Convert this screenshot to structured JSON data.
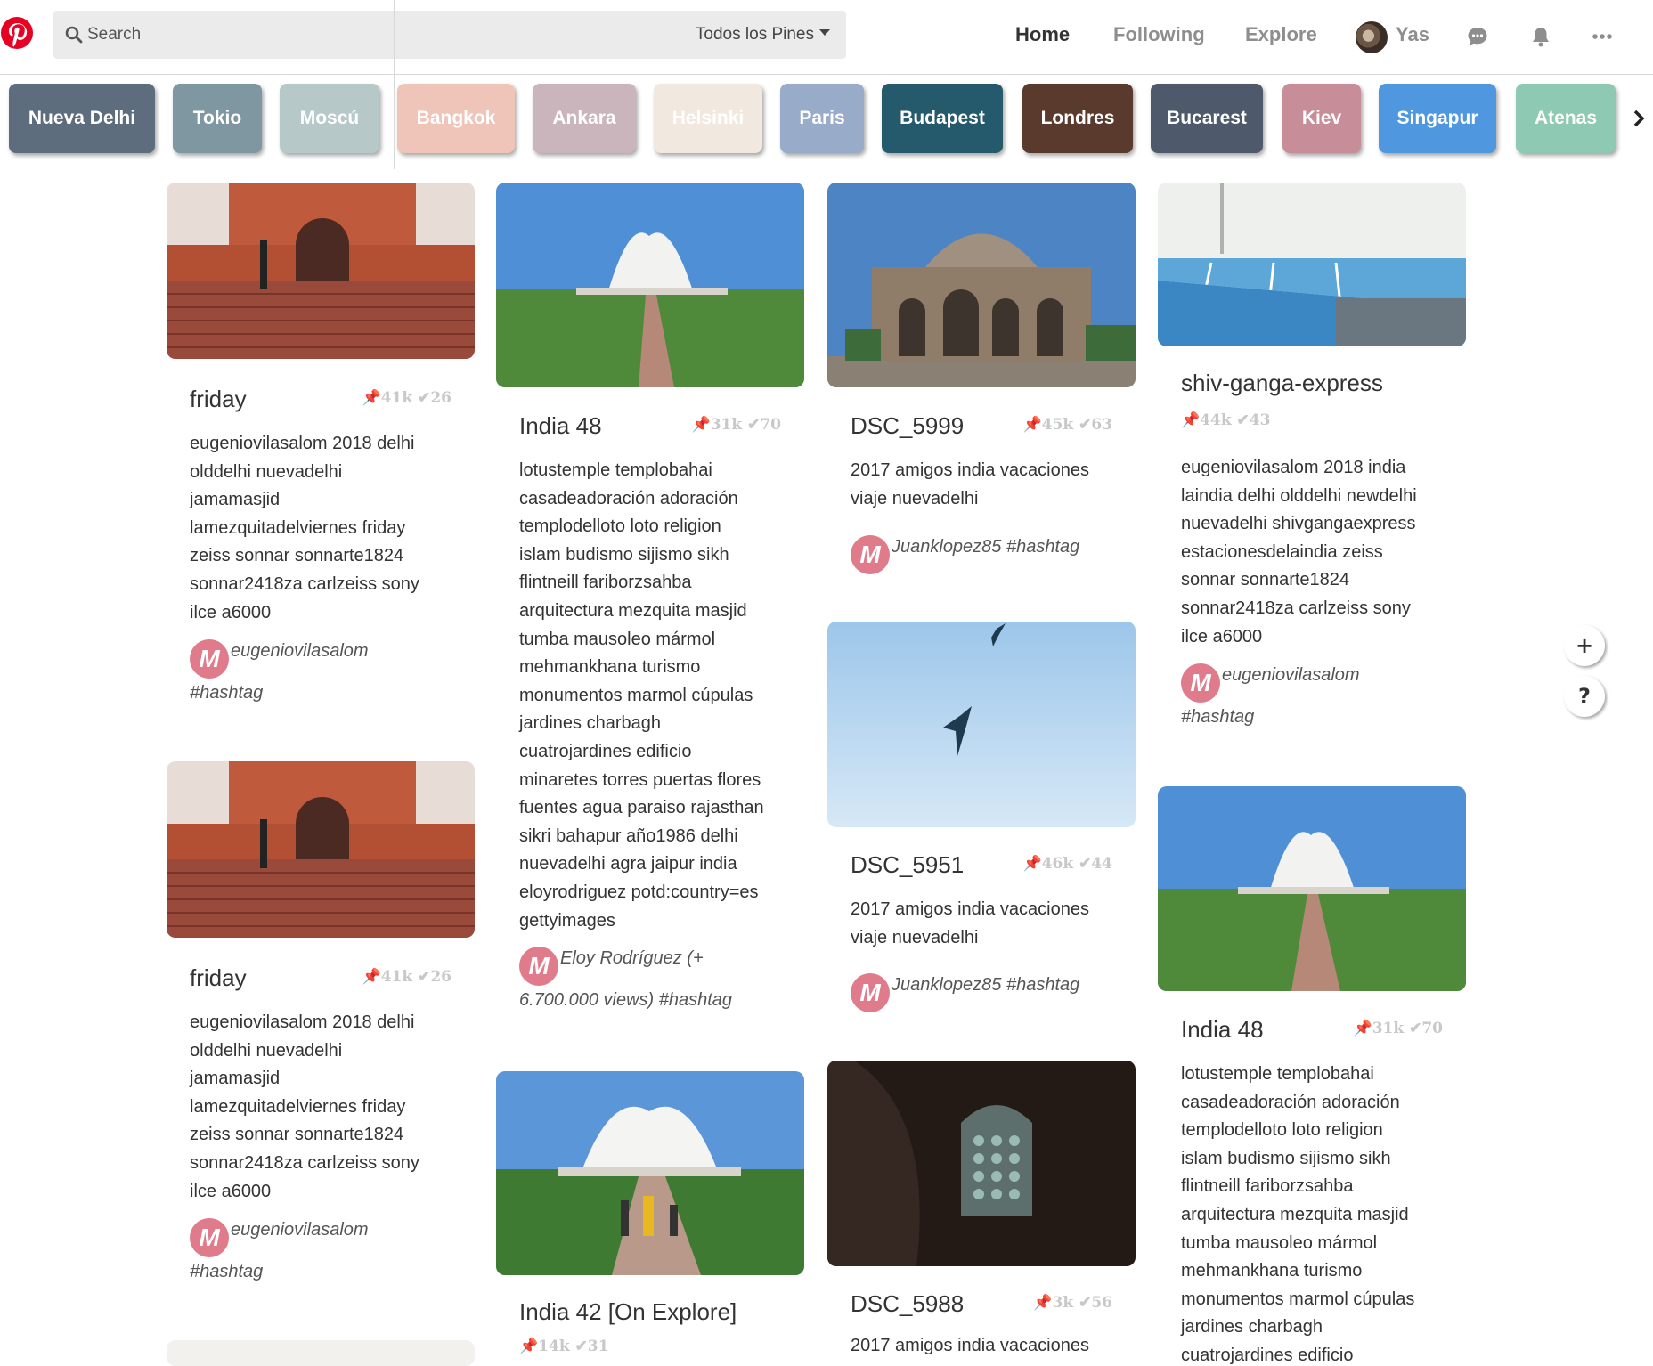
{
  "header": {
    "search_placeholder": "Search",
    "search_scope": "Todos los Pines",
    "nav": {
      "home": "Home",
      "following": "Following",
      "explore": "Explore",
      "user": "Yas"
    }
  },
  "cities": [
    {
      "label": "Nueva Delhi",
      "color": "#5d6d7e"
    },
    {
      "label": "Tokio",
      "color": "#7f97a1"
    },
    {
      "label": "Moscú",
      "color": "#b7c8c9"
    },
    {
      "label": "Bangkok",
      "color": "#efc4b9"
    },
    {
      "label": "Ankara",
      "color": "#cbb5bd"
    },
    {
      "label": "Helsinki",
      "color": "#f1e8df"
    },
    {
      "label": "Paris",
      "color": "#98abc9"
    },
    {
      "label": "Budapest",
      "color": "#245a6b"
    },
    {
      "label": "Londres",
      "color": "#5b3a2e"
    },
    {
      "label": "Bucarest",
      "color": "#4e5a6b"
    },
    {
      "label": "Kiev",
      "color": "#c78d98"
    },
    {
      "label": "Singapur",
      "color": "#4f98e0"
    },
    {
      "label": "Atenas",
      "color": "#8ec9b4"
    }
  ],
  "pins": [
    {
      "title": "friday",
      "pins": "41k",
      "likes": "26",
      "description": [
        "eugeniovilasalom 2018 delhi",
        "olddelhi nuevadelhi",
        "jamamasjid",
        "lamezquitadelviernes friday",
        "zeiss sonnar sonnarte1824",
        "sonnar2418za carlzeiss sony",
        "ilce a6000"
      ],
      "author": [
        "eugeniovilasalom",
        "#hashtag"
      ],
      "image": "red-fort-mosque"
    },
    {
      "title": "friday",
      "pins": "41k",
      "likes": "26",
      "description": [
        "eugeniovilasalom 2018 delhi",
        "olddelhi nuevadelhi",
        "jamamasjid",
        "lamezquitadelviernes friday",
        "zeiss sonnar sonnarte1824",
        "sonnar2418za carlzeiss sony",
        "ilce a6000"
      ],
      "author": [
        "eugeniovilasalom",
        "#hashtag"
      ],
      "image": "red-fort-mosque"
    },
    {
      "title": "India 48",
      "pins": "31k",
      "likes": "70",
      "description": [
        "lotustemple templobahai",
        "casadeadoración adoración",
        "templodelloto loto religion",
        "islam budismo sijismo sikh",
        "flintneill fariborzsahba",
        "arquitectura mezquita masjid",
        "tumba mausoleo mármol",
        "mehmankhana turismo",
        "monumentos marmol cúpulas",
        "jardines charbagh",
        "cuatrojardines edificio",
        "minaretes torres puertas flores",
        "fuentes agua paraiso rajasthan",
        "sikri bahapur año1986 delhi",
        "nuevadelhi agra jaipur india",
        "eloyrodriguez potd:country=es",
        "gettyimages"
      ],
      "author": [
        "Eloy Rodríguez (+",
        "6.700.000 views) #hashtag"
      ],
      "image": "lotus-temple"
    },
    {
      "title": "India 42 [On Explore]",
      "pins": "14k",
      "likes": "31",
      "image": "lotus-temple-crowd"
    },
    {
      "title": "DSC_5999",
      "pins": "45k",
      "likes": "63",
      "description": [
        "2017 amigos india vacaciones",
        "viaje nuevadelhi"
      ],
      "author": [
        "Juanklopez85 #hashtag"
      ],
      "image": "tomb-dome"
    },
    {
      "title": "DSC_5951",
      "pins": "46k",
      "likes": "44",
      "description": [
        "2017 amigos india vacaciones",
        "viaje nuevadelhi"
      ],
      "author": [
        "Juanklopez85 #hashtag"
      ],
      "image": "birds-sky"
    },
    {
      "title": "DSC_5988",
      "pins": "3k",
      "likes": "56",
      "description": [
        "2017 amigos india vacaciones"
      ],
      "image": "lattice-window"
    },
    {
      "title": "shiv-ganga-express",
      "pins": "44k",
      "likes": "43",
      "description": [
        "eugeniovilasalom 2018 india",
        "laindia delhi olddelhi newdelhi",
        "nuevadelhi shivgangaexpress",
        "estacionesdelaindia zeiss",
        "sonnar sonnarte1824",
        "sonnar2418za carlzeiss sony",
        "ilce a6000"
      ],
      "author": [
        "eugeniovilasalom",
        "#hashtag"
      ],
      "image": "train-station"
    },
    {
      "title": "India 48",
      "pins": "31k",
      "likes": "70",
      "description": [
        "lotustemple templobahai",
        "casadeadoración adoración",
        "templodelloto loto religion",
        "islam budismo sijismo sikh",
        "flintneill fariborzsahba",
        "arquitectura mezquita masjid",
        "tumba mausoleo mármol",
        "mehmankhana turismo",
        "monumentos marmol cúpulas",
        "jardines charbagh",
        "cuatrojardines edificio"
      ],
      "image": "lotus-temple"
    }
  ],
  "badge_letter": "M",
  "floating": {
    "add": "+",
    "help": "?"
  },
  "colors": {
    "brand": "#e60023",
    "badge": "#e07b8c"
  }
}
